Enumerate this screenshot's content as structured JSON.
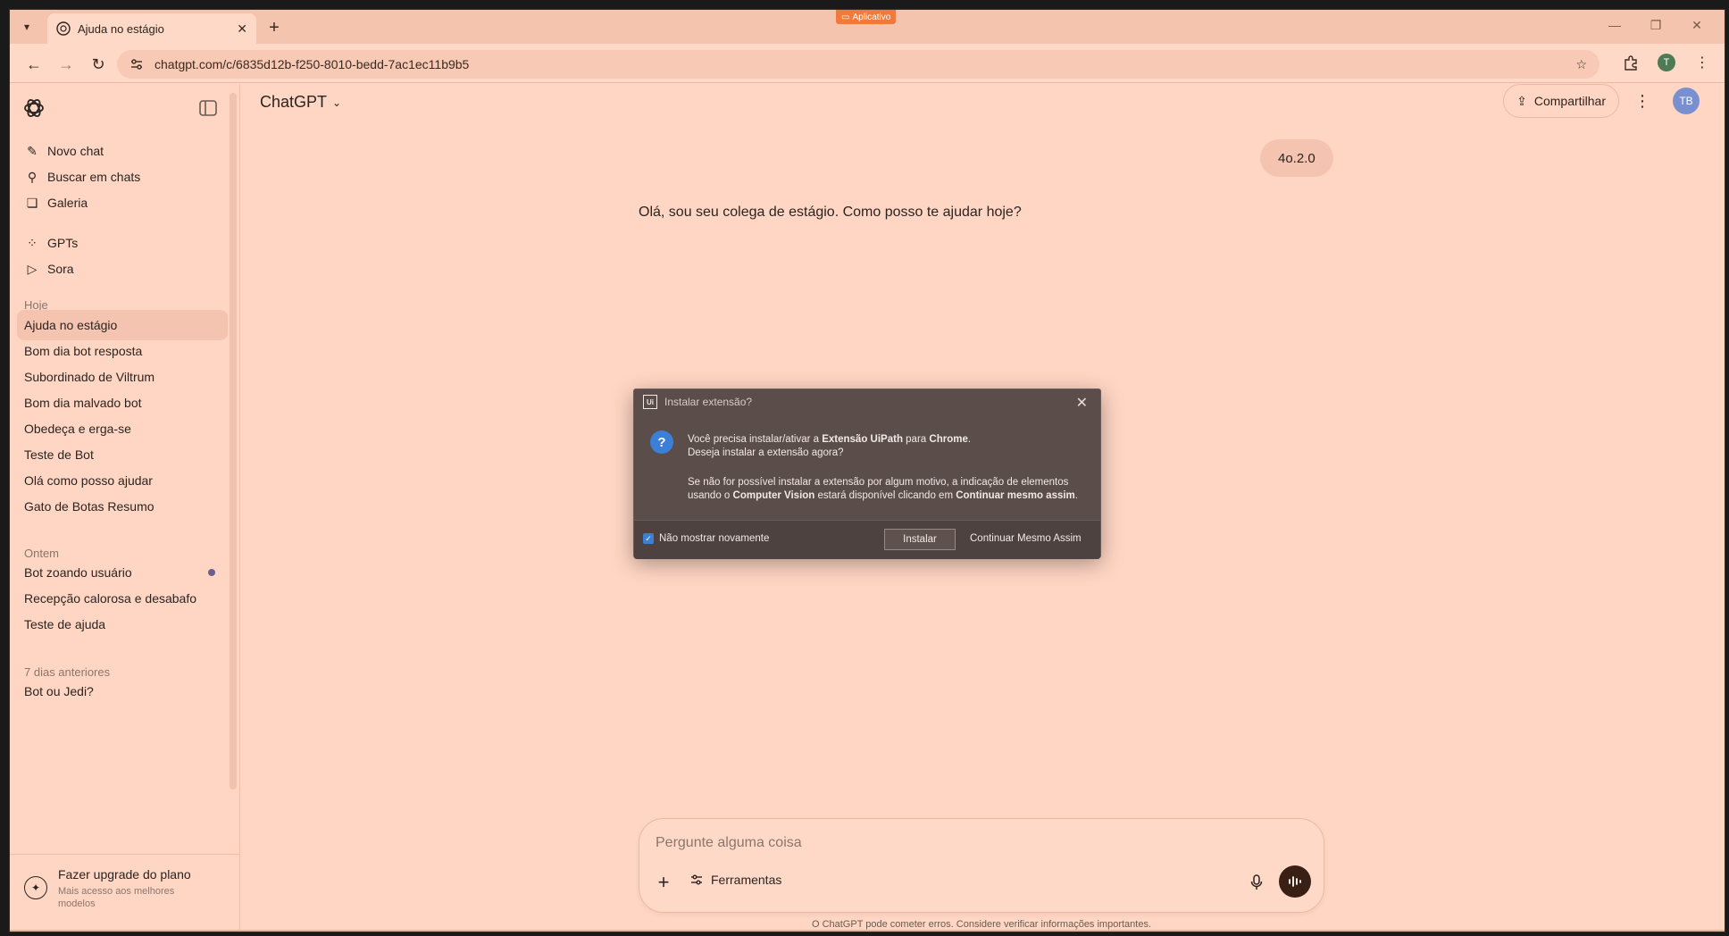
{
  "browser": {
    "tab_title": "Ajuda no estágio",
    "url": "chatgpt.com/c/6835d12b-f250-8010-bedd-7ac1ec11b9b5",
    "app_badge": "Aplicativo",
    "profile_initial": "T"
  },
  "sidebar": {
    "actions": [
      {
        "label": "Novo chat",
        "icon": "new-chat-icon"
      },
      {
        "label": "Buscar em chats",
        "icon": "search-icon"
      },
      {
        "label": "Galeria",
        "icon": "gallery-icon"
      }
    ],
    "apps": [
      {
        "label": "GPTs",
        "icon": "gpts-icon"
      },
      {
        "label": "Sora",
        "icon": "sora-icon"
      }
    ],
    "sections": {
      "today": "Hoje",
      "yesterday": "Ontem",
      "last7": "7 dias anteriores"
    },
    "today_items": [
      "Ajuda no estágio",
      "Bom dia bot resposta",
      "Subordinado de Viltrum",
      "Bom dia malvado bot",
      "Obedeça e erga-se",
      "Teste de Bot",
      "Olá como posso ajudar",
      "Gato de Botas Resumo"
    ],
    "yesterday_items": [
      "Bot zoando usuário",
      "Recepção calorosa e desabafo",
      "Teste de ajuda"
    ],
    "last7_items": [
      "Bot ou Jedi?"
    ],
    "upgrade": {
      "title": "Fazer upgrade do plano",
      "subtitle": "Mais acesso aos melhores modelos"
    }
  },
  "header": {
    "model": "ChatGPT",
    "share_label": "Compartilhar",
    "avatar": "TB"
  },
  "conversation": {
    "user_message": "4o.2.0",
    "assistant_message": "Olá, sou seu colega de estágio. Como posso te ajudar hoje?"
  },
  "composer": {
    "placeholder": "Pergunte alguma coisa",
    "tools_label": "Ferramentas",
    "disclaimer": "O ChatGPT pode cometer erros. Considere verificar informações importantes."
  },
  "dialog": {
    "title": "Instalar extensão?",
    "line1_pre": "Você precisa instalar/ativar a ",
    "line1_b1": "Extensão UiPath",
    "line1_mid": " para ",
    "line1_b2": "Chrome",
    "line1_end": ".",
    "line2": "Deseja instalar a extensão agora?",
    "line3": "Se não for possível instalar a extensão por algum motivo, a indicação de elementos",
    "line4_pre": "usando o ",
    "line4_b1": "Computer Vision",
    "line4_mid": " estará disponível clicando em ",
    "line4_b2": "Continuar mesmo assim",
    "line4_end": ".",
    "checkbox_label": "Não mostrar novamente",
    "checkbox_checked": true,
    "install_label": "Instalar",
    "continue_label": "Continuar Mesmo Assim"
  },
  "colors": {
    "page_bg": "#ffd6c4",
    "dialog_bg": "#5a4d4a",
    "accent_blue": "#3b7fd6",
    "avatar_bg": "#7a8fd0"
  }
}
